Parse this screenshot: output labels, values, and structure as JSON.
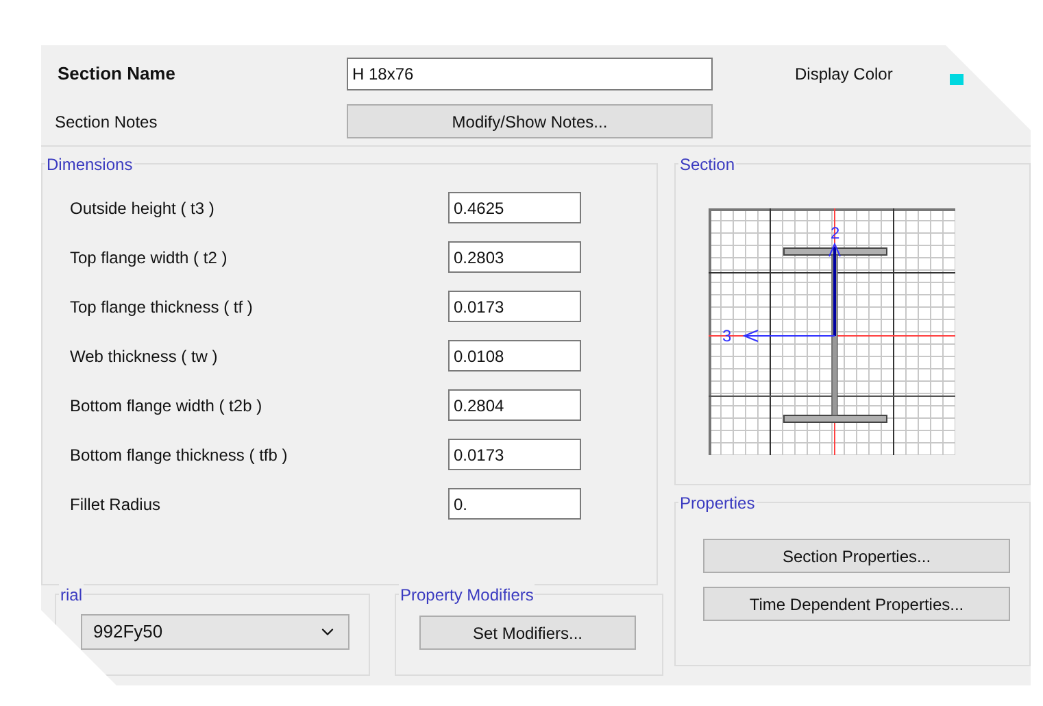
{
  "section_name": {
    "label": "Section Name",
    "value": "H 18x76"
  },
  "display_color": {
    "label": "Display Color",
    "color": "#00d8e0"
  },
  "section_notes": {
    "label": "Section Notes",
    "button": "Modify/Show Notes..."
  },
  "dimensions": {
    "title": "Dimensions",
    "fields": [
      {
        "label": "Outside height  ( t3 )",
        "value": "0.4625"
      },
      {
        "label": "Top flange width  ( t2 )",
        "value": "0.2803"
      },
      {
        "label": "Top flange thickness  ( tf )",
        "value": "0.0173"
      },
      {
        "label": "Web thickness  ( tw )",
        "value": "0.0108"
      },
      {
        "label": "Bottom flange width  ( t2b )",
        "value": "0.2804"
      },
      {
        "label": "Bottom flange thickness  ( tfb )",
        "value": "0.0173"
      },
      {
        "label": "Fillet Radius",
        "value": "0."
      }
    ]
  },
  "section": {
    "title": "Section",
    "axis_labels": [
      "2",
      "3"
    ]
  },
  "properties": {
    "title": "Properties",
    "buttons": [
      "Section Properties...",
      "Time Dependent Properties..."
    ]
  },
  "material": {
    "title": "rial",
    "value": "992Fy50"
  },
  "property_modifiers": {
    "title": "Property Modifiers",
    "button": "Set Modifiers..."
  }
}
